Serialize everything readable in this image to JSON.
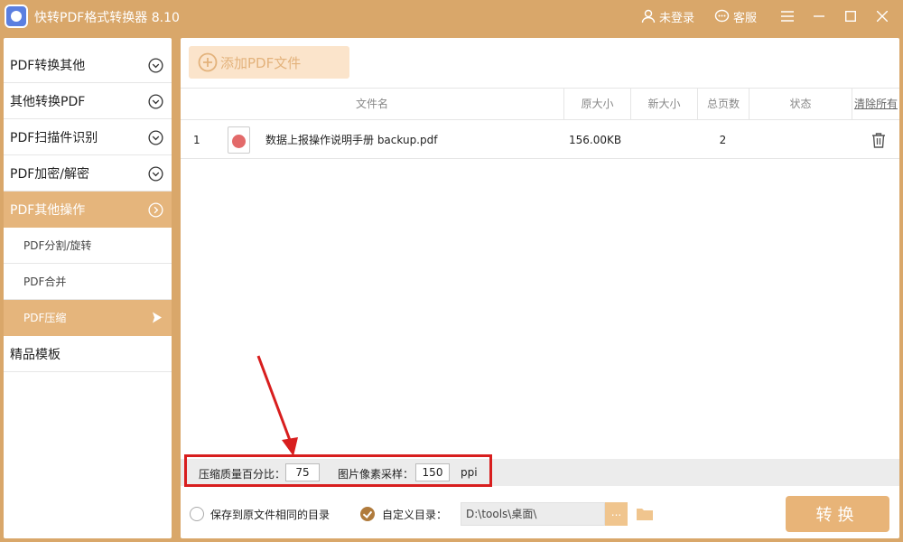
{
  "titlebar": {
    "app_title": "快转PDF格式转换器 8.10",
    "login_label": "未登录",
    "service_label": "客服",
    "icons": [
      "user-icon",
      "chat-icon",
      "menu-icon",
      "minimize-icon",
      "maximize-icon",
      "close-icon"
    ]
  },
  "sidebar": {
    "items": [
      {
        "label": "PDF转换其他"
      },
      {
        "label": "其他转换PDF"
      },
      {
        "label": "PDF扫描件识别"
      },
      {
        "label": "PDF加密/解密"
      },
      {
        "label": "PDF其他操作"
      }
    ],
    "sub_items": [
      {
        "label": "PDF分割/旋转"
      },
      {
        "label": "PDF合并"
      },
      {
        "label": "PDF压缩"
      }
    ],
    "templates": {
      "label": "精品模板"
    }
  },
  "main": {
    "add_button": "添加PDF文件",
    "columns": {
      "name": "文件名",
      "orig_size": "原大小",
      "new_size": "新大小",
      "pages": "总页数",
      "status": "状态",
      "clear_all": "清除所有"
    },
    "rows": [
      {
        "index": "1",
        "name": "数据上报操作说明手册 backup.pdf",
        "orig_size": "156.00KB",
        "new_size": "",
        "pages": "2",
        "status": ""
      }
    ]
  },
  "settings": {
    "quality_label": "压缩质量百分比：",
    "quality_value": "75",
    "ppi_label": "图片像素采样：",
    "ppi_value": "150",
    "ppi_unit": "ppi"
  },
  "output": {
    "same_dir_label": "保存到原文件相同的目录",
    "custom_dir_label": "自定义目录：",
    "custom_dir_value": "D:\\tools\\桌面\\",
    "browse_label": "...",
    "convert_label": "转换"
  },
  "colors": {
    "accent": "#d9a76a",
    "active_item": "#e5b57c",
    "annotation": "#d81e1e"
  }
}
